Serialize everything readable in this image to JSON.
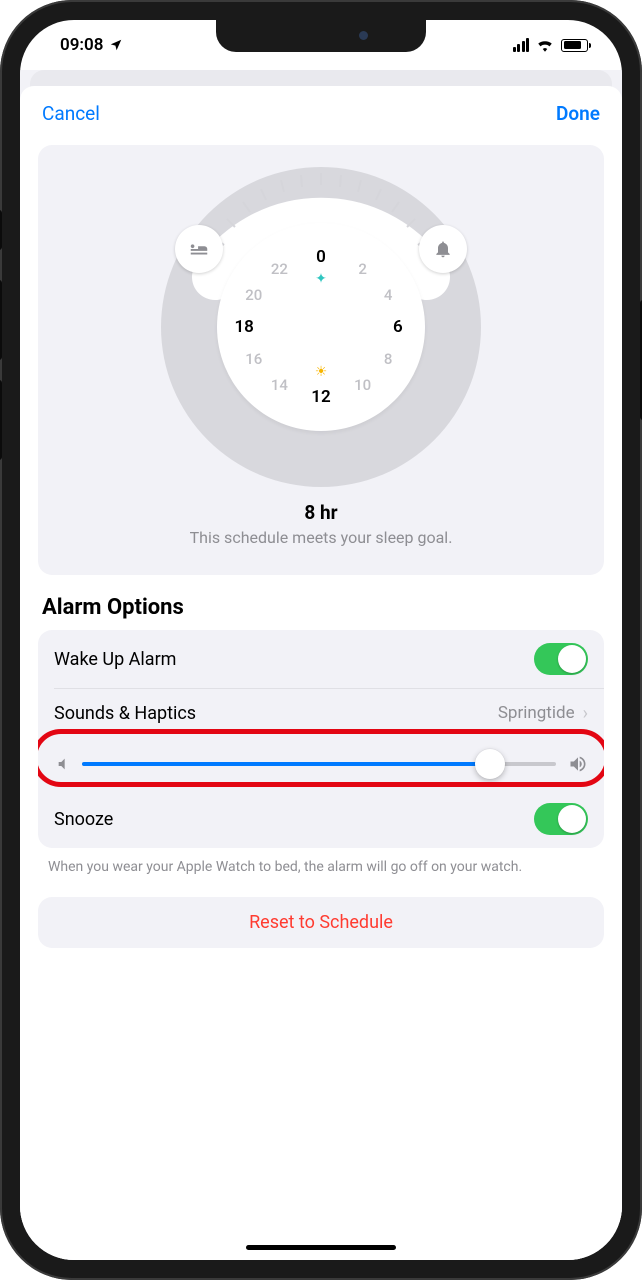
{
  "status": {
    "time": "09:08"
  },
  "nav": {
    "cancel": "Cancel",
    "done": "Done"
  },
  "dial": {
    "hours": [
      "0",
      "2",
      "4",
      "6",
      "8",
      "10",
      "12",
      "14",
      "16",
      "18",
      "20",
      "22"
    ],
    "duration": "8 hr",
    "subtitle": "This schedule meets your sleep goal."
  },
  "section_title": "Alarm Options",
  "rows": {
    "wake_alarm": "Wake Up Alarm",
    "sounds_haptics": "Sounds & Haptics",
    "sounds_value": "Springtide",
    "snooze": "Snooze"
  },
  "volume": {
    "percent": 86
  },
  "footer": "When you wear your Apple Watch to bed, the alarm will go off on your watch.",
  "reset": "Reset to Schedule"
}
